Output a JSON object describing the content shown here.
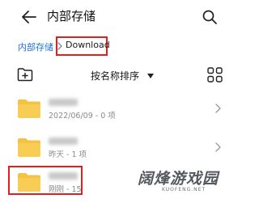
{
  "header": {
    "title": "内部存储",
    "back_icon": "arrow-left-icon",
    "search_icon": "search-icon"
  },
  "breadcrumb": {
    "root": "内部存储",
    "current": "Download",
    "separator_icon": "chevron-right-icon"
  },
  "toolbar": {
    "sort_label": "按名称排序",
    "new_folder_icon": "folder-plus-icon",
    "view_toggle_icon": "grid-view-icon"
  },
  "items": [
    {
      "meta": "2022/06/09 - 0 项"
    },
    {
      "meta": "昨天 - 1 项"
    },
    {
      "meta": "刚刚 - 15"
    }
  ],
  "watermark": {
    "text": "阔烽游戏园",
    "sub": "KUOFENG.NET"
  },
  "colors": {
    "accent_blue": "#1e74d6",
    "folder_yellow": "#f5c242",
    "highlight_red": "#e0201c",
    "meta_gray": "#8a8a8a"
  }
}
